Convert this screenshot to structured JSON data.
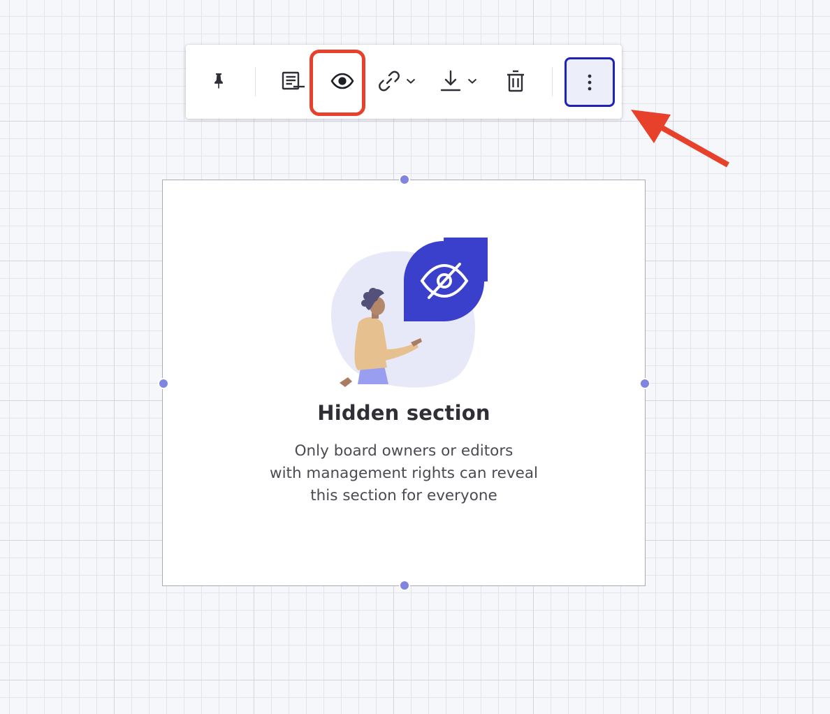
{
  "toolbar": {
    "buttons": [
      {
        "id": "pin",
        "icon": "pin-icon"
      },
      {
        "id": "description",
        "icon": "lines-icon"
      },
      {
        "id": "visibility",
        "icon": "eye-icon"
      },
      {
        "id": "link",
        "icon": "link-icon",
        "has_dropdown": true
      },
      {
        "id": "download",
        "icon": "download-icon",
        "has_dropdown": true
      },
      {
        "id": "delete",
        "icon": "trash-icon"
      },
      {
        "id": "more",
        "icon": "kebab-icon"
      }
    ]
  },
  "annotations": {
    "highlight_color": "#e8412b",
    "arrow_color": "#e8412b",
    "active_button_border": "#1e22b8"
  },
  "section": {
    "title": "Hidden section",
    "description_lines": [
      "Only board owners or editors",
      "with management rights can reveal",
      "this section for everyone"
    ],
    "illustration_icon": "eye-slash-icon"
  },
  "colors": {
    "accent": "#3a40cc",
    "handle": "#8086e0",
    "canvas": "#f6f7fb"
  }
}
